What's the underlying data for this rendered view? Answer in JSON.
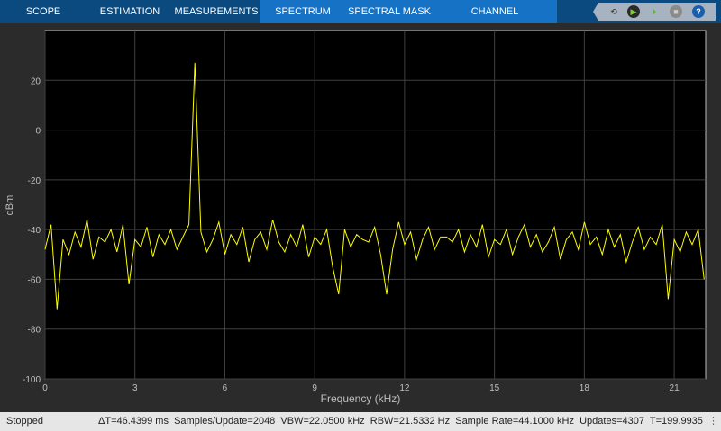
{
  "tabs": {
    "scope": "SCOPE",
    "estimation": "ESTIMATION",
    "measurements": "MEASUREMENTS",
    "spectrum": "SPECTRUM",
    "spectral_mask": "SPECTRAL MASK",
    "channel_measurements": "CHANNEL MEASUREMENTS"
  },
  "controls": [
    "highlight-simulink-icon",
    "run-icon",
    "step-forward-icon",
    "stop-icon",
    "help-icon"
  ],
  "status": {
    "state": "Stopped",
    "info": "ΔT=46.4399 ms  Samples/Update=2048  VBW=22.0500 kHz  RBW=21.5332 Hz  Sample Rate=44.1000 kHz  Updates=4307  T=199.9935"
  },
  "chart_data": {
    "type": "line",
    "title": "",
    "xlabel": "Frequency (kHz)",
    "ylabel": "dBm",
    "xlim": [
      0,
      22.05
    ],
    "ylim": [
      -100,
      40
    ],
    "grid": true,
    "xticks": [
      "0",
      "3",
      "6",
      "9",
      "12",
      "15",
      "18",
      "21"
    ],
    "yticks": [
      "20",
      "0",
      "-20",
      "-40",
      "-60",
      "-80",
      "-100"
    ],
    "colors": {
      "line": "#ffff00",
      "background": "#000000",
      "grid": "#404040",
      "axis_text": "#bfbfbf"
    },
    "x": [
      0,
      0.2,
      0.4,
      0.6,
      0.8,
      1,
      1.2,
      1.4,
      1.6,
      1.8,
      2,
      2.2,
      2.4,
      2.6,
      2.8,
      3,
      3.2,
      3.4,
      3.6,
      3.8,
      4,
      4.2,
      4.4,
      4.6,
      4.8,
      5,
      5.2,
      5.4,
      5.6,
      5.8,
      6,
      6.2,
      6.4,
      6.6,
      6.8,
      7,
      7.2,
      7.4,
      7.6,
      7.8,
      8,
      8.2,
      8.4,
      8.6,
      8.8,
      9,
      9.2,
      9.4,
      9.6,
      9.8,
      10,
      10.2,
      10.4,
      10.6,
      10.8,
      11,
      11.2,
      11.4,
      11.6,
      11.8,
      12,
      12.2,
      12.4,
      12.6,
      12.8,
      13,
      13.2,
      13.4,
      13.6,
      13.8,
      14,
      14.2,
      14.4,
      14.6,
      14.8,
      15,
      15.2,
      15.4,
      15.6,
      15.8,
      16,
      16.2,
      16.4,
      16.6,
      16.8,
      17,
      17.2,
      17.4,
      17.6,
      17.8,
      18,
      18.2,
      18.4,
      18.6,
      18.8,
      19,
      19.2,
      19.4,
      19.6,
      19.8,
      20,
      20.2,
      20.4,
      20.6,
      20.8,
      21,
      21.2,
      21.4,
      21.6,
      21.8,
      22
    ],
    "y": [
      -48,
      -38,
      -72,
      -44,
      -50,
      -41,
      -47,
      -36,
      -52,
      -43,
      -45,
      -40,
      -49,
      -38,
      -62,
      -44,
      -47,
      -39,
      -51,
      -42,
      -46,
      -40,
      -48,
      -43,
      -38,
      27,
      -41,
      -49,
      -44,
      -37,
      -50,
      -42,
      -46,
      -39,
      -53,
      -44,
      -41,
      -48,
      -36,
      -45,
      -49,
      -42,
      -47,
      -38,
      -51,
      -43,
      -46,
      -40,
      -55,
      -66,
      -40,
      -47,
      -42,
      -44,
      -45,
      -39,
      -50,
      -66,
      -48,
      -37,
      -46,
      -41,
      -52,
      -44,
      -39,
      -48,
      -43,
      -43,
      -45,
      -40,
      -49,
      -42,
      -47,
      -38,
      -51,
      -44,
      -46,
      -40,
      -50,
      -43,
      -38,
      -47,
      -42,
      -49,
      -45,
      -39,
      -52,
      -44,
      -41,
      -48,
      -37,
      -46,
      -43,
      -50,
      -40,
      -47,
      -42,
      -53,
      -45,
      -39,
      -48,
      -43,
      -46,
      -38,
      -68,
      -44,
      -49,
      -41,
      -46,
      -40,
      -60
    ]
  }
}
